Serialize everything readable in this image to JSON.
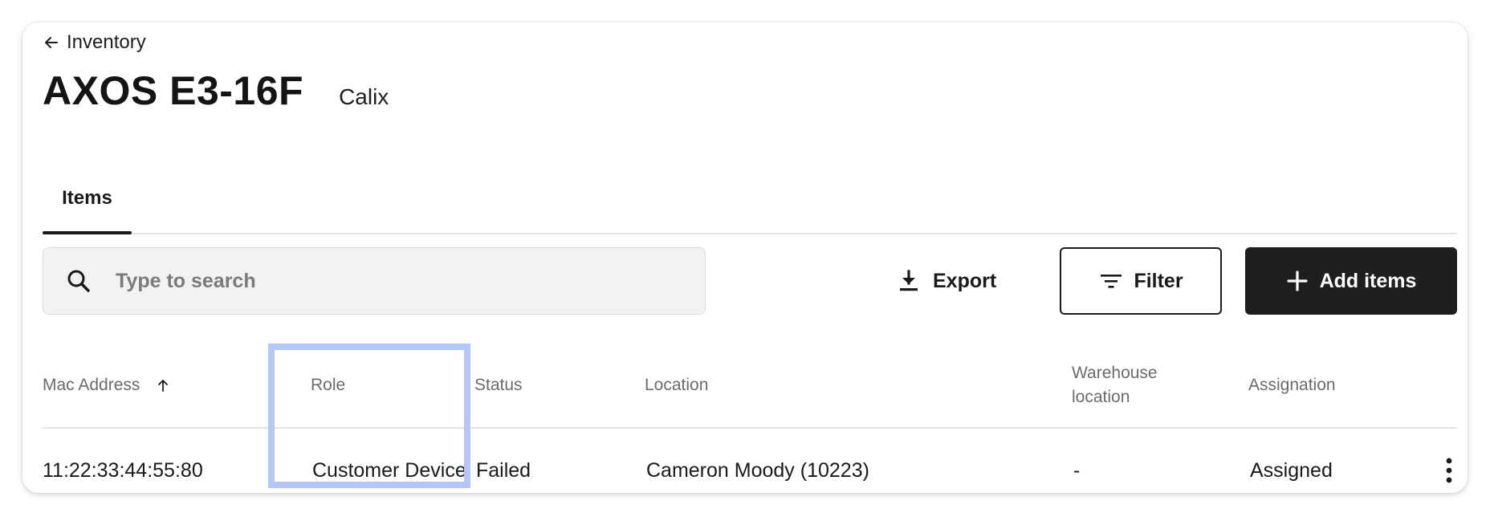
{
  "breadcrumb": {
    "back_label": "Inventory"
  },
  "header": {
    "title": "AXOS E3-16F",
    "vendor": "Calix"
  },
  "tabs": [
    {
      "label": "Items",
      "active": true
    }
  ],
  "search": {
    "placeholder": "Type to search",
    "value": ""
  },
  "toolbar": {
    "export_label": "Export",
    "filter_label": "Filter",
    "add_label": "Add items"
  },
  "table": {
    "columns": [
      {
        "label": "Mac Address",
        "sort": "ascending"
      },
      {
        "label": "Role"
      },
      {
        "label": "Status"
      },
      {
        "label": "Location"
      },
      {
        "label": "Warehouse location"
      },
      {
        "label": "Assignation"
      }
    ],
    "rows": [
      {
        "mac_address": "11:22:33:44:55:80",
        "role": "Customer Device",
        "status": "Failed",
        "location": "Cameron Moody (10223)",
        "warehouse_location": "-",
        "assignation": "Assigned"
      }
    ]
  },
  "icons": {
    "back": "arrow-left-icon",
    "search": "search-icon",
    "export": "download-icon",
    "filter": "filter-icon",
    "add": "plus-icon",
    "sort": "arrow-up-icon",
    "more": "more-vertical-icon"
  },
  "colors": {
    "primary_button": "#1f1f1f",
    "highlight": "#b4c8f5",
    "search_bg": "#f2f2f2",
    "header_text": "#6b6b6b"
  }
}
